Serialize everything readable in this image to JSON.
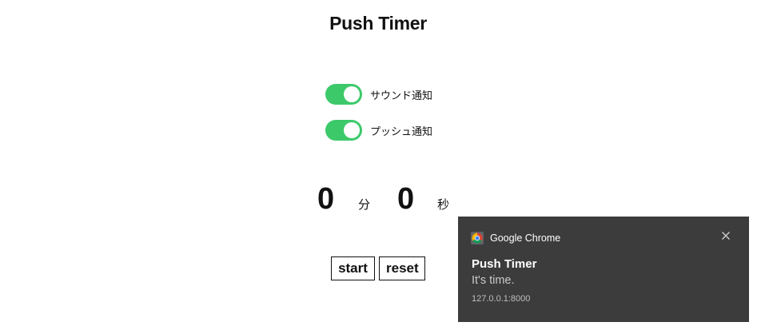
{
  "app": {
    "title": "Push Timer"
  },
  "settings": {
    "sound_label": "サウンド通知",
    "sound_on": true,
    "push_label": "プッシュ通知",
    "push_on": true
  },
  "timer": {
    "minutes": "0",
    "minutes_unit": "分",
    "seconds": "0",
    "seconds_unit": "秒"
  },
  "controls": {
    "start_label": "start",
    "reset_label": "reset"
  },
  "notification": {
    "app_name": "Google Chrome",
    "app_icon": "chrome-icon",
    "close_icon": "close-icon",
    "title": "Push Timer",
    "body": "It's time.",
    "origin": "127.0.0.1:8000"
  },
  "colors": {
    "toggle_on": "#3cc96a",
    "notification_bg": "#3c3c3c"
  }
}
